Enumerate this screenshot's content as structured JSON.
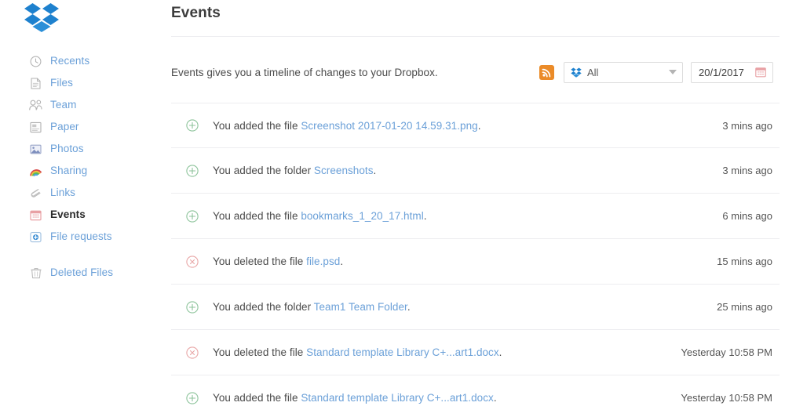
{
  "app": {
    "logo": "dropbox-logo",
    "brand_blue": "#1e81ce"
  },
  "sidebar": {
    "primary_items": [
      {
        "label": "Recents",
        "icon": "clock-icon",
        "active": false
      },
      {
        "label": "Files",
        "icon": "file-icon",
        "active": false
      },
      {
        "label": "Team",
        "icon": "team-icon",
        "active": false
      },
      {
        "label": "Paper",
        "icon": "paper-icon",
        "active": false
      },
      {
        "label": "Photos",
        "icon": "photos-icon",
        "active": false
      },
      {
        "label": "Sharing",
        "icon": "rainbow-icon",
        "active": false
      },
      {
        "label": "Links",
        "icon": "paperclip-icon",
        "active": false
      },
      {
        "label": "Events",
        "icon": "calendar-icon",
        "active": true
      },
      {
        "label": "File requests",
        "icon": "file-request-icon",
        "active": false
      }
    ],
    "secondary_items": [
      {
        "label": "Deleted Files",
        "icon": "trash-icon",
        "active": false
      }
    ]
  },
  "header": {
    "title": "Events",
    "subtitle": "Events gives you a timeline of changes to your Dropbox."
  },
  "toolbar": {
    "rss_icon": "rss-icon",
    "filter": {
      "icon": "dropbox-glyph-icon",
      "value": "All",
      "chevron": "chevron-down-icon"
    },
    "date": {
      "value": "20/1/2017",
      "icon": "calendar-icon"
    }
  },
  "events": [
    {
      "type": "added",
      "icon": "plus-circle-icon",
      "prefix": "You added the file ",
      "target": "Screenshot 2017-01-20 14.59.31.png",
      "suffix": ".",
      "time": "3 mins ago"
    },
    {
      "type": "added",
      "icon": "plus-circle-icon",
      "prefix": "You added the folder ",
      "target": "Screenshots",
      "suffix": ".",
      "time": "3 mins ago"
    },
    {
      "type": "added",
      "icon": "plus-circle-icon",
      "prefix": "You added the file ",
      "target": "bookmarks_1_20_17.html",
      "suffix": ".",
      "time": "6 mins ago"
    },
    {
      "type": "deleted",
      "icon": "x-circle-icon",
      "prefix": "You deleted the file ",
      "target": "file.psd",
      "suffix": ".",
      "time": "15 mins ago"
    },
    {
      "type": "added",
      "icon": "plus-circle-icon",
      "prefix": "You added the folder ",
      "target": "Team1 Team Folder",
      "suffix": ".",
      "time": "25 mins ago"
    },
    {
      "type": "deleted",
      "icon": "x-circle-icon",
      "prefix": "You deleted the file ",
      "target": "Standard template Library C+...art1.docx",
      "suffix": ".",
      "time": "Yesterday 10:58 PM"
    },
    {
      "type": "added",
      "icon": "plus-circle-icon",
      "prefix": "You added the file ",
      "target": "Standard template Library C+...art1.docx",
      "suffix": ".",
      "time": "Yesterday 10:58 PM"
    }
  ],
  "colors": {
    "link": "#6ba0d8",
    "added": "#7bb98a",
    "deleted": "#e79a9a",
    "rss_orange": "#eb8b28",
    "calendar_pink": "#e8a0a4",
    "divider": "#ededf0"
  }
}
